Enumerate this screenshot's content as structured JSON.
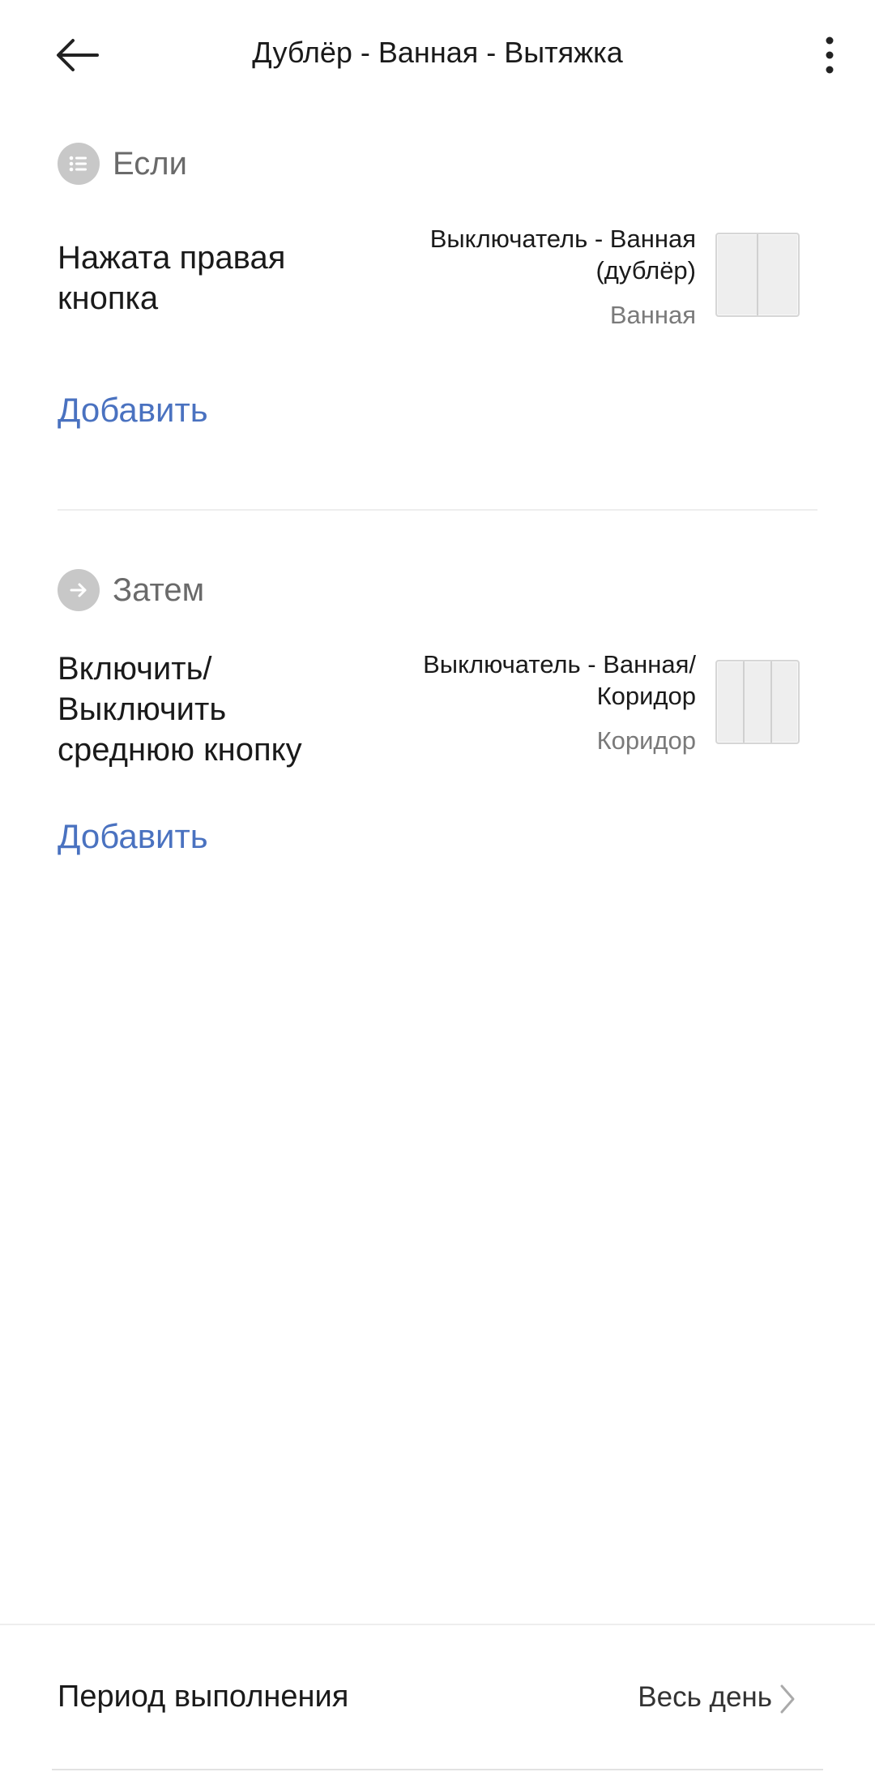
{
  "header": {
    "title": "Дублёр - Ванная - Вытяжка",
    "back_icon": "arrow-left-icon",
    "more_icon": "more-vertical-icon"
  },
  "if_section": {
    "label": "Если",
    "icon": "list-icon",
    "condition": {
      "action": "Нажата правая кнопка",
      "device_name": "Выключатель - Ванная (дублёр)",
      "room": "Ванная",
      "device_icon": "two-key-switch"
    },
    "add_label": "Добавить"
  },
  "then_section": {
    "label": "Затем",
    "icon": "arrow-right-icon",
    "action": {
      "action": "Включить/ Выключить среднюю кнопку",
      "device_name": "Выключатель - Ванная/ Коридор",
      "room": "Коридор",
      "device_icon": "three-key-switch"
    },
    "add_label": "Добавить"
  },
  "footer": {
    "period_label": "Период выполнения",
    "period_value": "Весь день"
  },
  "colors": {
    "link": "#4a72c0",
    "section_icon_bg": "#c8c8c8"
  }
}
